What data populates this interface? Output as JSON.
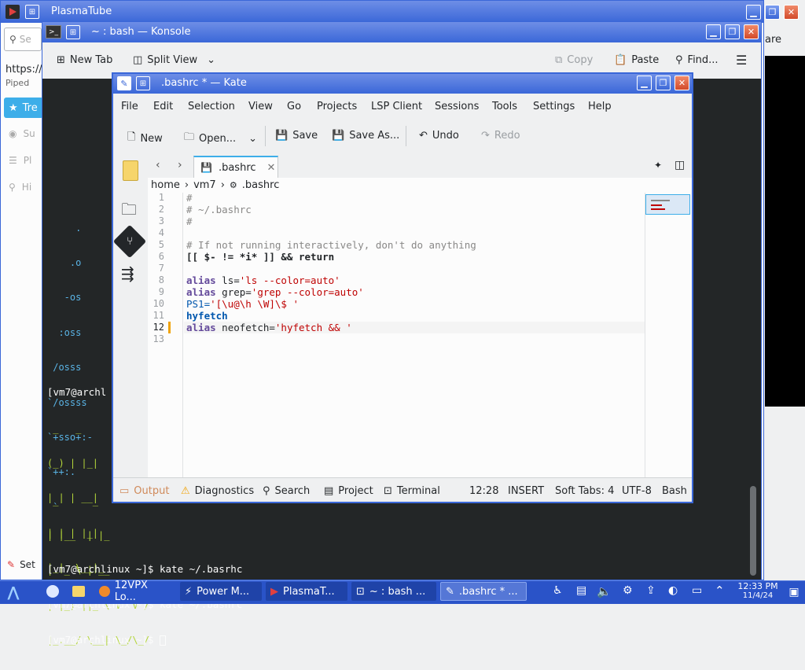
{
  "plasmatube": {
    "title": "PlasmaTube",
    "url_prefix": "https://",
    "piped": "Piped",
    "search_prefix": "Se",
    "sidebar_active": "Tre",
    "sidebar_items": [
      "Su",
      "Pl",
      "Hi"
    ],
    "right_label": "are",
    "bottom_label": "Set"
  },
  "konsole": {
    "title": "~ : bash — Konsole",
    "toolbar": {
      "new_tab": "New Tab",
      "split_view": "Split View",
      "copy": "Copy",
      "paste": "Paste",
      "find": "Find..."
    },
    "ascii_logo": [
      "     .",
      "    .o",
      "   -os",
      "  :oss",
      " /osss",
      "`/ossss",
      "`+sso+:-",
      "`++:.",
      " `"
    ],
    "prompt_partial": "[vm7@archl",
    "fig1": [
      " _   _ ",
      "(_) | |_|",
      "| | | __|",
      "| | | |_|",
      "|_|  \\__|_"
    ],
    "fig2": [
      " _      _",
      "| |__  | |_",
      "| '_ \\ | __",
      "| |_) ||_ \\ V  V /",
      "|_.__/ \\__| \\_/\\_/"
    ],
    "commands": [
      "[vm7@archlinux ~]$ kate ~/.basrhc",
      "[vm7@archlinux ~]$ kate ~/.bashrc",
      "[vm7@archlinux ~]$ "
    ]
  },
  "kate": {
    "title": ".bashrc * — Kate",
    "menu": [
      "File",
      "Edit",
      "Selection",
      "View",
      "Go",
      "Projects",
      "LSP Client",
      "Sessions",
      "Tools",
      "Settings",
      "Help"
    ],
    "toolbar": {
      "new": "New",
      "open": "Open...",
      "save": "Save",
      "save_as": "Save As...",
      "undo": "Undo",
      "redo": "Redo"
    },
    "tab_label": ".bashrc",
    "breadcrumb": [
      "home",
      "vm7",
      ".bashrc"
    ],
    "lines": [
      {
        "n": "1",
        "text": "#"
      },
      {
        "n": "2",
        "text": "# ~/.bashrc"
      },
      {
        "n": "3",
        "text": "#"
      },
      {
        "n": "4",
        "text": ""
      },
      {
        "n": "5",
        "text": "# If not running interactively, don't do anything"
      },
      {
        "n": "6",
        "a": "[[ $- != *i* ]] && return"
      },
      {
        "n": "7",
        "text": ""
      },
      {
        "n": "8",
        "kw": "alias",
        "rest": " ls=",
        "str": "'ls --color=auto'"
      },
      {
        "n": "9",
        "kw": "alias",
        "rest": " grep=",
        "str": "'grep --color=auto'"
      },
      {
        "n": "10",
        "ps": "PS1=",
        "str": "'[\\u@\\h \\W]\\$ '"
      },
      {
        "n": "11",
        "hy": "hyfetch"
      },
      {
        "n": "12",
        "kw": "alias",
        "rest": " neofetch=",
        "str": "'hyfetch && '"
      },
      {
        "n": "13",
        "text": ""
      }
    ],
    "statusbar": {
      "output": "Output",
      "diagnostics": "Diagnostics",
      "search": "Search",
      "project": "Project",
      "terminal": "Terminal",
      "position": "12:28",
      "mode": "INSERT",
      "tabs": "Soft Tabs: 4",
      "encoding": "UTF-8",
      "syntax": "Bash"
    }
  },
  "taskbar": {
    "tasks": [
      "12VPX Lo...",
      "Power M...",
      "PlasmaT...",
      "~ : bash ...",
      ".bashrc * ..."
    ],
    "time": "12:33 PM",
    "date": "11/4/24"
  },
  "colors": {
    "accent": "#3a67d8",
    "terminal_bg": "#232627",
    "taskbar_bg": "#2a53c8",
    "comment": "#898887",
    "string": "#bf0303",
    "keyword": "#644a9b",
    "builtin": "#0057ae",
    "warning": "#f0a30a",
    "ascii_green": "#b4d63a",
    "ascii_blue": "#5ab4e6"
  }
}
